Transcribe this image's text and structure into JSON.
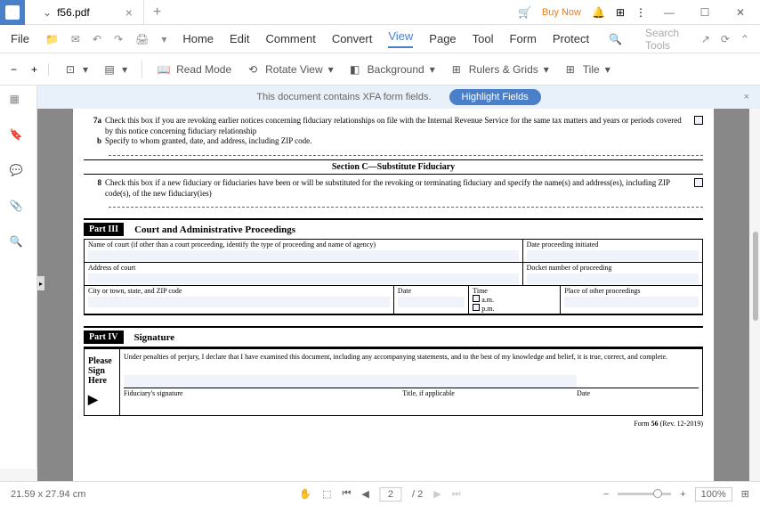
{
  "tab": {
    "filename": "f56.pdf"
  },
  "titlebar": {
    "buy_now": "Buy Now"
  },
  "menu": {
    "file": "File",
    "home": "Home",
    "edit": "Edit",
    "comment": "Comment",
    "convert": "Convert",
    "view": "View",
    "page": "Page",
    "tool": "Tool",
    "form": "Form",
    "protect": "Protect",
    "search_placeholder": "Search Tools"
  },
  "toolbar": {
    "read_mode": "Read Mode",
    "rotate_view": "Rotate View",
    "background": "Background",
    "rulers_grids": "Rulers & Grids",
    "tile": "Tile"
  },
  "infobar": {
    "message": "This document contains XFA form fields.",
    "highlight": "Highlight Fields"
  },
  "doc": {
    "line7a_num": "7a",
    "line7a_text": "Check this box if you are revoking earlier notices concerning fiduciary relationships on file with the Internal Revenue Service for the same tax matters and years or periods covered by this notice concerning fiduciary relationship",
    "line7b_num": "b",
    "line7b_text": "Specify to whom granted, date, and address, including ZIP code.",
    "section_c": "Section C—Substitute Fiduciary",
    "line8_num": "8",
    "line8_text": "Check this box if a new fiduciary or fiduciaries have been or will be substituted for the revoking or terminating fiduciary and specify the name(s) and address(es), including ZIP code(s), of the new fiduciary(ies)",
    "part3_badge": "Part III",
    "part3_title": "Court and Administrative Proceedings",
    "court_name": "Name of court (if other than a court proceeding, identify the type of proceeding and name of agency)",
    "date_initiated": "Date proceeding initiated",
    "court_address": "Address of court",
    "docket": "Docket number of proceeding",
    "city_state": "City or town, state, and ZIP code",
    "date_label": "Date",
    "time_label": "Time",
    "am": "a.m.",
    "pm": "p.m.",
    "place_other": "Place of other proceedings",
    "part4_badge": "Part IV",
    "part4_title": "Signature",
    "please_sign": "Please Sign Here",
    "perjury": "Under penalties of perjury, I declare that I have examined this document, including any accompanying statements, and to the best of my knowledge and belief, it is true, correct, and complete.",
    "fiduciary_sig": "Fiduciary's signature",
    "title_if": "Title, if applicable",
    "sig_date": "Date",
    "form_footer_pre": "Form ",
    "form_footer_num": "56",
    "form_footer_rev": " (Rev. 12-2019)"
  },
  "statusbar": {
    "dimensions": "21.59 x 27.94 cm",
    "page_current": "2",
    "page_total": "/ 2",
    "zoom": "100%"
  }
}
